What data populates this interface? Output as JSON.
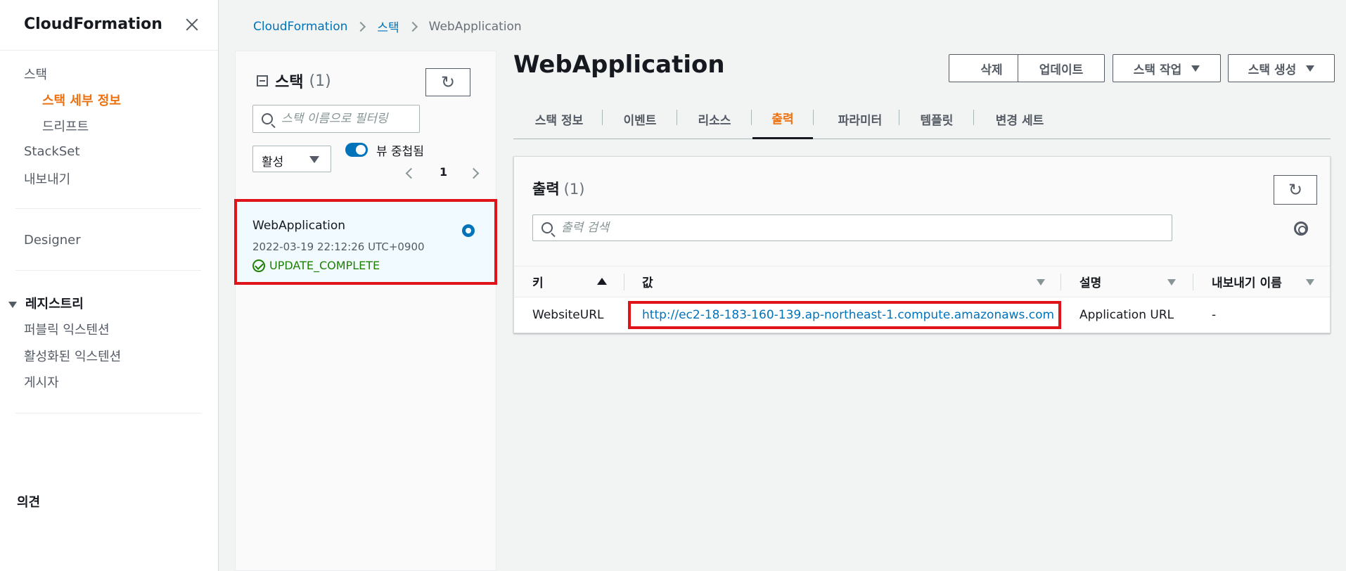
{
  "sidebar": {
    "title": "CloudFormation",
    "items": {
      "stacks": "스택",
      "stack_details": "스택 세부 정보",
      "drift": "드리프트",
      "stackset": "StackSet",
      "exports": "내보내기",
      "designer": "Designer",
      "registry": "레지스트리",
      "public_extensions": "퍼블릭 익스텐션",
      "activated_extensions": "활성화된 익스텐션",
      "publisher": "게시자",
      "feedback": "의견"
    }
  },
  "breadcrumb": {
    "root": "CloudFormation",
    "stacks": "스택",
    "current": "WebApplication"
  },
  "stack_panel": {
    "title": "스택",
    "count": "(1)",
    "search_placeholder": "스택 이름으로 필터링",
    "filter_value": "활성",
    "toggle_label": "뷰 중첩됨",
    "page": "1",
    "stack": {
      "name": "WebApplication",
      "timestamp": "2022-03-19 22:12:26 UTC+0900",
      "status": "UPDATE_COMPLETE"
    }
  },
  "main": {
    "title": "WebApplication",
    "buttons": {
      "delete": "삭제",
      "update": "업데이트",
      "stack_actions": "스택 작업",
      "create_stack": "스택 생성"
    },
    "tabs": [
      "스택 정보",
      "이벤트",
      "리소스",
      "출력",
      "파라미터",
      "템플릿",
      "변경 세트"
    ],
    "active_tab": "출력"
  },
  "outputs": {
    "title": "출력",
    "count": "(1)",
    "search_placeholder": "출력 검색",
    "columns": [
      "키",
      "값",
      "설명",
      "내보내기 이름"
    ],
    "rows": [
      {
        "key": "WebsiteURL",
        "value": "http://ec2-18-183-160-139.ap-northeast-1.compute.amazonaws.com",
        "description": "Application URL",
        "export_name": "-"
      }
    ]
  },
  "colors": {
    "accent": "#ec7211",
    "link": "#0073bb",
    "success": "#1d8102",
    "highlight": "#e0121a"
  }
}
